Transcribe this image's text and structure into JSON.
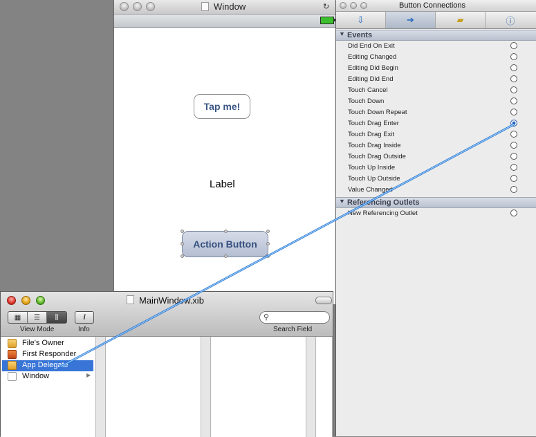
{
  "window": {
    "title": "Window",
    "tap_button_label": "Tap me!",
    "label_text": "Label",
    "action_button_label": "Action Button"
  },
  "connections": {
    "title": "Button Connections",
    "tabs": [
      "Attributes",
      "Connections",
      "Size",
      "Identity"
    ],
    "events_header": "Events",
    "events": [
      {
        "label": "Did End On Exit",
        "connected": false
      },
      {
        "label": "Editing Changed",
        "connected": false
      },
      {
        "label": "Editing Did Begin",
        "connected": false
      },
      {
        "label": "Editing Did End",
        "connected": false
      },
      {
        "label": "Touch Cancel",
        "connected": false
      },
      {
        "label": "Touch Down",
        "connected": false
      },
      {
        "label": "Touch Down Repeat",
        "connected": false
      },
      {
        "label": "Touch Drag Enter",
        "connected": true
      },
      {
        "label": "Touch Drag Exit",
        "connected": false
      },
      {
        "label": "Touch Drag Inside",
        "connected": false
      },
      {
        "label": "Touch Drag Outside",
        "connected": false
      },
      {
        "label": "Touch Up Inside",
        "connected": false
      },
      {
        "label": "Touch Up Outside",
        "connected": false
      },
      {
        "label": "Value Changed",
        "connected": false
      }
    ],
    "outlets_header": "Referencing Outlets",
    "outlets": [
      {
        "label": "New Referencing Outlet",
        "connected": false
      }
    ]
  },
  "xib": {
    "title": "MainWindow.xib",
    "view_mode_label": "View Mode",
    "info_label": "Info",
    "info_icon": "i",
    "search_label": "Search Field",
    "search_value": "",
    "items": [
      {
        "label": "File's Owner",
        "icon": "cube-icon",
        "selected": false
      },
      {
        "label": "First Responder",
        "icon": "responder-cube-icon",
        "selected": false
      },
      {
        "label": "App Delegate",
        "icon": "cube-icon",
        "selected": true
      },
      {
        "label": "Window",
        "icon": "window-icon",
        "selected": false
      }
    ]
  },
  "colors": {
    "selection": "#3875d7",
    "connection_line": "#3fa7ff",
    "button_text": "#3a5686"
  }
}
